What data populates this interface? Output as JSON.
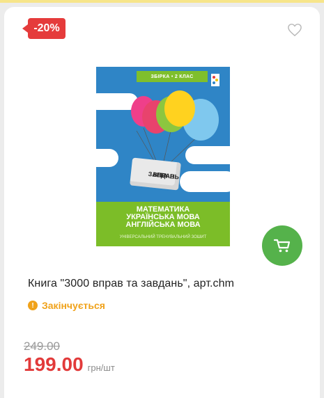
{
  "badge": {
    "discount": "-20%",
    "color": "#e53b3b"
  },
  "icons": {
    "favorite": "heart-outline-icon",
    "cart": "cart-icon",
    "status": "exclamation-icon"
  },
  "cover": {
    "series_tag": "ЗБІРКА • 2 КЛАС",
    "box_line1": "ВПРАВ",
    "box_line2": "ТА",
    "box_line3": "ЗАВДАНЬ",
    "big_number": "3000",
    "subjects": [
      "МАТЕМАТИКА",
      "УКРАЇНСЬКА МОВА",
      "АНГЛІЙСЬКА МОВА"
    ],
    "subtitle": "УНІВЕРСАЛЬНИЙ ТРЕНУВАЛЬНИЙ ЗОШИТ"
  },
  "product": {
    "title": "Книга \"3000 вправ та завдань\", арт.chm",
    "status": "Закінчується",
    "old_price": "249.00",
    "price": "199.00",
    "unit": "грн/шт"
  },
  "colors": {
    "accent_green": "#55b24b",
    "status_orange": "#f0a21a",
    "price_red": "#e23a3a"
  }
}
